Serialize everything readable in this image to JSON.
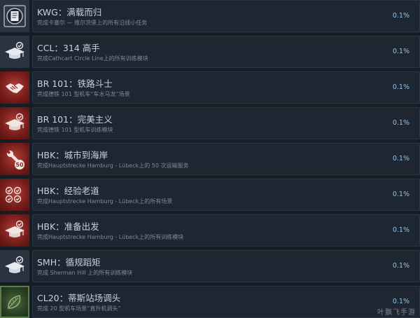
{
  "achievements": [
    {
      "title": "KWG：满载而归",
      "desc": "完成卡塞尔 — 维尔茨堡上的所有沿线小任务",
      "percent": "0.1%",
      "icon": "document-icon"
    },
    {
      "title": "CCL：314 高手",
      "desc": "完成Cathcart Circle Line上的所有训练模块",
      "percent": "0.1%",
      "icon": "graduation-cap-icon"
    },
    {
      "title": "BR 101：铁路斗士",
      "desc": "完成德铁 101 型机车“车水马龙”场景",
      "percent": "0.1%",
      "icon": "handshake-icon"
    },
    {
      "title": "BR 101：完美主义",
      "desc": "完成德铁 101 型机车训练模块",
      "percent": "0.1%",
      "icon": "graduation-cap-icon"
    },
    {
      "title": "HBK：城市到海岸",
      "desc": "完成Hauptstrecke Hamburg - Lübeck上的 50 次运输服务",
      "percent": "0.1%",
      "icon": "wrench-50-icon"
    },
    {
      "title": "HBK：经验老道",
      "desc": "完成Hauptstrecke Hamburg - Lübeck上的所有场景",
      "percent": "0.1%",
      "icon": "checkmarks-icon"
    },
    {
      "title": "HBK：准备出发",
      "desc": "完成Hauptstrecke Hamburg - Lübeck上的所有训练模块",
      "percent": "0.1%",
      "icon": "graduation-cap-icon"
    },
    {
      "title": "SMH：循规蹈矩",
      "desc": "完成 Sherman Hill 上的所有训练模块",
      "percent": "0.1%",
      "icon": "graduation-cap-icon"
    },
    {
      "title": "CL20：蒂斯站场调头",
      "desc": "完成 20 型机车场景“直升机调头”",
      "percent": "0.1%",
      "icon": "leaf-icon"
    }
  ],
  "watermark": "叶飘飞手游"
}
